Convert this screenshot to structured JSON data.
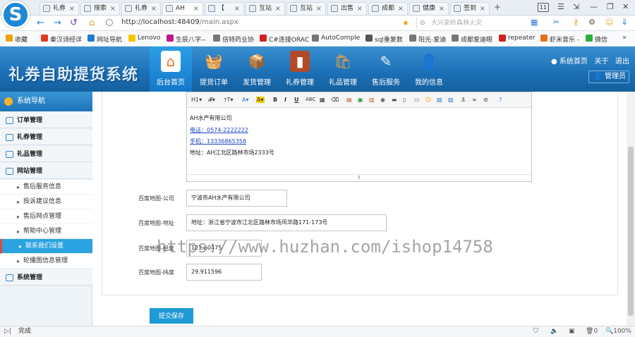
{
  "browser": {
    "tabs": [
      {
        "label": "礼券"
      },
      {
        "label": "搜索"
      },
      {
        "label": "礼券"
      },
      {
        "label": "AH"
      },
      {
        "label": "【"
      },
      {
        "label": "互站"
      },
      {
        "label": "互站"
      },
      {
        "label": "出售"
      },
      {
        "label": "成都"
      },
      {
        "label": "健康"
      },
      {
        "label": "签到"
      }
    ],
    "tab_count": "11",
    "url_host": "http://localhost:48409",
    "url_path": "/main.aspx",
    "search_placeholder": "大兴安岭森林火灾",
    "bookmarks": [
      {
        "label": "收藏",
        "color": "#f0a000"
      },
      {
        "label": "秦汉诗经详",
        "color": "#e0381c"
      },
      {
        "label": "网址导航",
        "color": "#1e7bd6"
      },
      {
        "label": "Lenovo",
        "color": "#f5c400"
      },
      {
        "label": "生辰八字--",
        "color": "#c0188a"
      },
      {
        "label": "倍特药业协",
        "color": "#777777"
      },
      {
        "label": "C#连接ORAC",
        "color": "#d12020"
      },
      {
        "label": "AutoComple",
        "color": "#777777"
      },
      {
        "label": "sql重复数",
        "color": "#555555"
      },
      {
        "label": "阳光-爱迪",
        "color": "#777777"
      },
      {
        "label": "成都爱迪眼",
        "color": "#777777"
      },
      {
        "label": "repeater",
        "color": "#d12020"
      },
      {
        "label": "虾米音乐 -",
        "color": "#e8701a"
      },
      {
        "label": "微信",
        "color": "#2aae3a"
      }
    ],
    "status_left": "完成",
    "status_zoom": "100%",
    "status_count": "0"
  },
  "app": {
    "title": "礼券自助提货系统",
    "nav": [
      {
        "label": "后台首页",
        "icon": "home-icon"
      },
      {
        "label": "提货订单",
        "icon": "basket-icon"
      },
      {
        "label": "发货管理",
        "icon": "shipping-icon"
      },
      {
        "label": "礼券管理",
        "icon": "book-icon"
      },
      {
        "label": "礼品管理",
        "icon": "gift-icon"
      },
      {
        "label": "售后服务",
        "icon": "service-icon"
      },
      {
        "label": "我的信息",
        "icon": "user-icon"
      }
    ],
    "header_links": {
      "home": "系统首页",
      "about": "关于",
      "exit": "退出"
    },
    "admin_label": "管理员"
  },
  "sidebar": {
    "title": "系统导航",
    "groups": [
      {
        "label": "订单管理"
      },
      {
        "label": "礼券管理"
      },
      {
        "label": "礼品管理"
      },
      {
        "label": "网站管理"
      }
    ],
    "subitems": [
      {
        "label": "售后服务信息"
      },
      {
        "label": "投诉建议信息"
      },
      {
        "label": "售后网点管理"
      },
      {
        "label": "帮助中心管理"
      },
      {
        "label": "联系我们设置"
      },
      {
        "label": "轮播图信息管理"
      }
    ],
    "last_group": {
      "label": "系统管理"
    }
  },
  "editor": {
    "lines": [
      {
        "text": "AH水产有限公司",
        "link": false
      },
      {
        "text": "电话：0574-2222222",
        "link": true
      },
      {
        "text": "手机：13336865358",
        "link": true
      },
      {
        "text": "地址：AH江北区路林市场2333号",
        "link": false
      }
    ]
  },
  "form": {
    "company_label": "百度地图-公司",
    "company_value": "宁波市AH水产有限公司",
    "address_label": "百度地图-地址",
    "address_value": "地址：浙江省宁波市江北区路林市场风华路171-173号",
    "lng_label": "百度地图-经度",
    "lng_value": "121.60475",
    "lat_label": "百度地图-纬度",
    "lat_value": "29.911596",
    "save_label": "提交保存"
  },
  "watermark": "https://www.huzhan.com/ishop14758"
}
